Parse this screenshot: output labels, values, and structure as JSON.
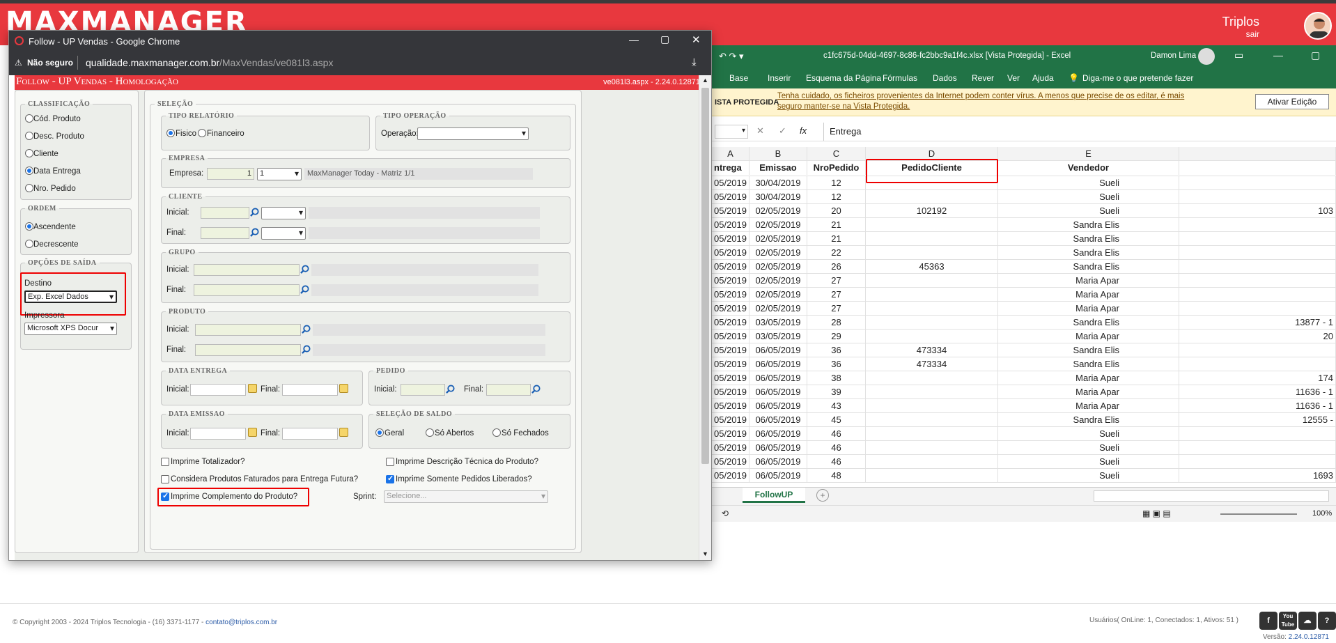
{
  "app": {
    "logo": "MAXMANAGER",
    "user_name": "Triplos",
    "logout": "sair"
  },
  "footer": {
    "copyright": "© Copyright 2003 - 2024 Triplos Tecnologia - (16) 3371-1177 - ",
    "email": "contato@triplos.com.br",
    "users": "Usuários( OnLine: 1, Conectados: 1, Ativos: 51 )",
    "version_label": "Versão: ",
    "version": "2.24.0.12871",
    "social": [
      "f",
      "You Tube",
      "☁",
      "?"
    ]
  },
  "popup": {
    "title": "Follow - UP Vendas - Google Chrome",
    "security": "Não seguro",
    "url_host": "qualidade.maxmanager.com.br",
    "url_path": "/MaxVendas/ve081l3.aspx",
    "form_title": "Follow - UP Vendas  - Homologação",
    "form_version": "ve081l3.aspx - 2.24.0.12871"
  },
  "classificacao": {
    "legend": "Classificação",
    "options": [
      "Cód. Produto",
      "Desc. Produto",
      "Cliente",
      "Data Entrega",
      "Nro. Pedido"
    ],
    "selected": "Data Entrega"
  },
  "ordem": {
    "legend": "Ordem",
    "options": [
      "Ascendente",
      "Decrescente"
    ],
    "selected": "Ascendente"
  },
  "saida": {
    "legend": "Opções de Saída",
    "destino_label": "Destino",
    "destino_value": "Exp. Excel Dados",
    "impressora_label": "Impressora",
    "impressora_value": "Microsoft XPS Docur"
  },
  "selecao": {
    "legend": "Seleção",
    "tipo_relatorio": {
      "legend": "Tipo Relatório",
      "options": [
        "Fisico",
        "Financeiro"
      ],
      "selected": "Fisico"
    },
    "tipo_operacao": {
      "legend": "Tipo Operação",
      "label": "Operação:",
      "value": ""
    },
    "empresa": {
      "legend": "Empresa",
      "label": "Empresa:",
      "code": "1",
      "select": "1",
      "name": "MaxManager Today - Matriz 1/1"
    },
    "cliente": {
      "legend": "Cliente",
      "inicial": "Inicial:",
      "final": "Final:"
    },
    "grupo": {
      "legend": "Grupo",
      "inicial": "Inicial:",
      "final": "Final:"
    },
    "produto": {
      "legend": "Produto",
      "inicial": "Inicial:",
      "final": "Final:"
    },
    "data_entrega": {
      "legend": "Data Entrega",
      "inicial": "Inicial:",
      "final": "Final:"
    },
    "pedido": {
      "legend": "Pedido",
      "inicial": "Inicial:",
      "final": "Final:"
    },
    "data_emissao": {
      "legend": "Data Emissao",
      "inicial": "Inicial:",
      "final": "Final:"
    },
    "saldo": {
      "legend": "Seleção de Saldo",
      "options": [
        "Geral",
        "Só Abertos",
        "Só Fechados"
      ],
      "selected": "Geral"
    },
    "checks": {
      "totalizador": "Imprime Totalizador?",
      "desc_tecnica": "Imprime Descrição Técnica do Produto?",
      "faturados": "Considera Produtos Faturados para Entrega Futura?",
      "somente_liberados": "Imprime Somente Pedidos Liberados?",
      "complemento": "Imprime Complemento do Produto?"
    },
    "sprint_label": "Sprint:",
    "sprint_placeholder": "Selecione..."
  },
  "excel": {
    "title": "c1fc675d-04dd-4697-8c86-fc2bbc9a1f4c.xlsx  [Vista Protegida]  -  Excel",
    "user": "Damon Lima",
    "ribbon": [
      "Base",
      "Inserir",
      "Esquema da Página",
      "Fórmulas",
      "Dados",
      "Rever",
      "Ver",
      "Ajuda"
    ],
    "tell_me": "Diga-me o que pretende fazer",
    "warn_label": "ISTA PROTEGIDA",
    "warn_text": "Tenha cuidado, os ficheiros provenientes da Internet podem conter vírus. A menos que precise de os editar, é mais seguro manter-se na Vista Protegida.",
    "warn_button": "Ativar Edição",
    "formula": "Entrega",
    "columns": [
      "A",
      "B",
      "C",
      "D",
      "E"
    ],
    "headers": [
      "ntrega",
      "Emissao",
      "NroPedido",
      "PedidoCliente",
      "Vendedor"
    ],
    "rows": [
      [
        "05/2019",
        "30/04/2019",
        "12",
        "",
        "Sueli",
        ""
      ],
      [
        "05/2019",
        "30/04/2019",
        "12",
        "",
        "Sueli",
        ""
      ],
      [
        "05/2019",
        "02/05/2019",
        "20",
        "102192",
        "Sueli",
        "103"
      ],
      [
        "05/2019",
        "02/05/2019",
        "21",
        "",
        "Sandra Elis",
        ""
      ],
      [
        "05/2019",
        "02/05/2019",
        "21",
        "",
        "Sandra Elis",
        ""
      ],
      [
        "05/2019",
        "02/05/2019",
        "22",
        "",
        "Sandra Elis",
        ""
      ],
      [
        "05/2019",
        "02/05/2019",
        "26",
        "45363",
        "Sandra Elis",
        ""
      ],
      [
        "05/2019",
        "02/05/2019",
        "27",
        "",
        "Maria Apar",
        ""
      ],
      [
        "05/2019",
        "02/05/2019",
        "27",
        "",
        "Maria Apar",
        ""
      ],
      [
        "05/2019",
        "02/05/2019",
        "27",
        "",
        "Maria Apar",
        ""
      ],
      [
        "05/2019",
        "03/05/2019",
        "28",
        "",
        "Sandra Elis",
        "13877 - 1"
      ],
      [
        "05/2019",
        "03/05/2019",
        "29",
        "",
        "Maria Apar",
        "20"
      ],
      [
        "05/2019",
        "06/05/2019",
        "36",
        "473334",
        "Sandra Elis",
        ""
      ],
      [
        "05/2019",
        "06/05/2019",
        "36",
        "473334",
        "Sandra Elis",
        ""
      ],
      [
        "05/2019",
        "06/05/2019",
        "38",
        "",
        "Maria Apar",
        "174"
      ],
      [
        "05/2019",
        "06/05/2019",
        "39",
        "",
        "Maria Apar",
        "11636 - 1"
      ],
      [
        "05/2019",
        "06/05/2019",
        "43",
        "",
        "Maria Apar",
        "11636 - 1"
      ],
      [
        "05/2019",
        "06/05/2019",
        "45",
        "",
        "Sandra Elis",
        "12555 -"
      ],
      [
        "05/2019",
        "06/05/2019",
        "46",
        "",
        "Sueli",
        ""
      ],
      [
        "05/2019",
        "06/05/2019",
        "46",
        "",
        "Sueli",
        ""
      ],
      [
        "05/2019",
        "06/05/2019",
        "46",
        "",
        "Sueli",
        ""
      ],
      [
        "05/2019",
        "06/05/2019",
        "48",
        "",
        "Sueli",
        "1693"
      ]
    ],
    "sheet_tab": "FollowUP",
    "zoom": "100%"
  }
}
